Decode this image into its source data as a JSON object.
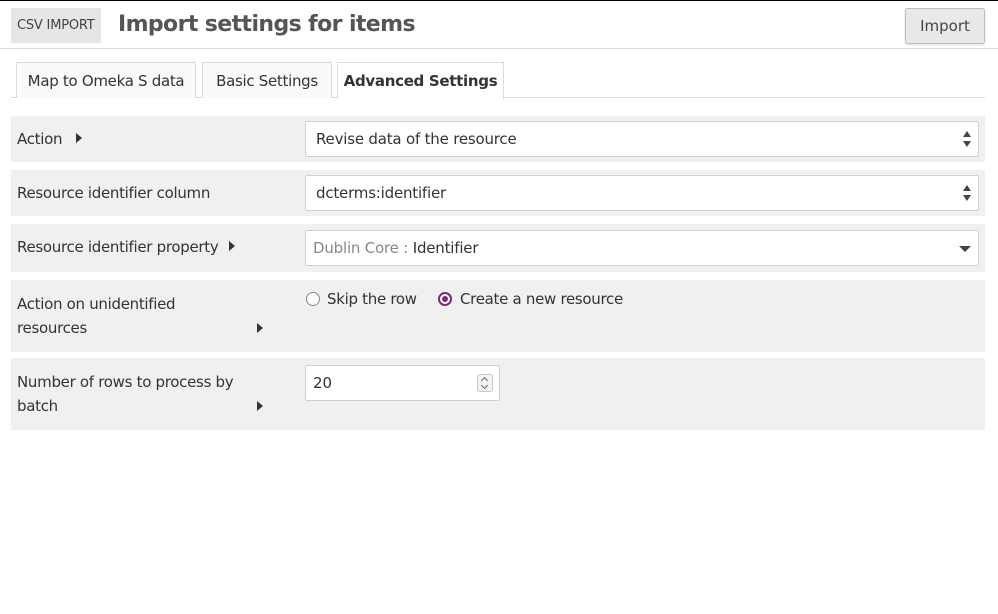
{
  "header": {
    "section_tag": "CSV IMPORT",
    "title": "Import settings for items",
    "import_label": "Import"
  },
  "tabs": [
    {
      "label": "Map to Omeka S data",
      "active": false
    },
    {
      "label": "Basic Settings",
      "active": false
    },
    {
      "label": "Advanced Settings",
      "active": true
    }
  ],
  "fields": {
    "action": {
      "label": "Action",
      "value": "Revise data of the resource"
    },
    "identifier_column": {
      "label": "Resource identifier column",
      "value": "dcterms:identifier"
    },
    "identifier_property": {
      "label": "Resource identifier property",
      "vocab": "Dublin Core :",
      "value": "Identifier"
    },
    "unidentified": {
      "label_line1": "Action on unidentified",
      "label_line2": "resources",
      "options": [
        {
          "label": "Skip the row",
          "selected": false
        },
        {
          "label": "Create a new resource",
          "selected": true
        }
      ]
    },
    "batch": {
      "label_line1": "Number of rows to process by",
      "label_line2": "batch",
      "value": "20"
    }
  },
  "colors": {
    "accent": "#7a2a73",
    "row_bg": "#f0f0f0"
  }
}
